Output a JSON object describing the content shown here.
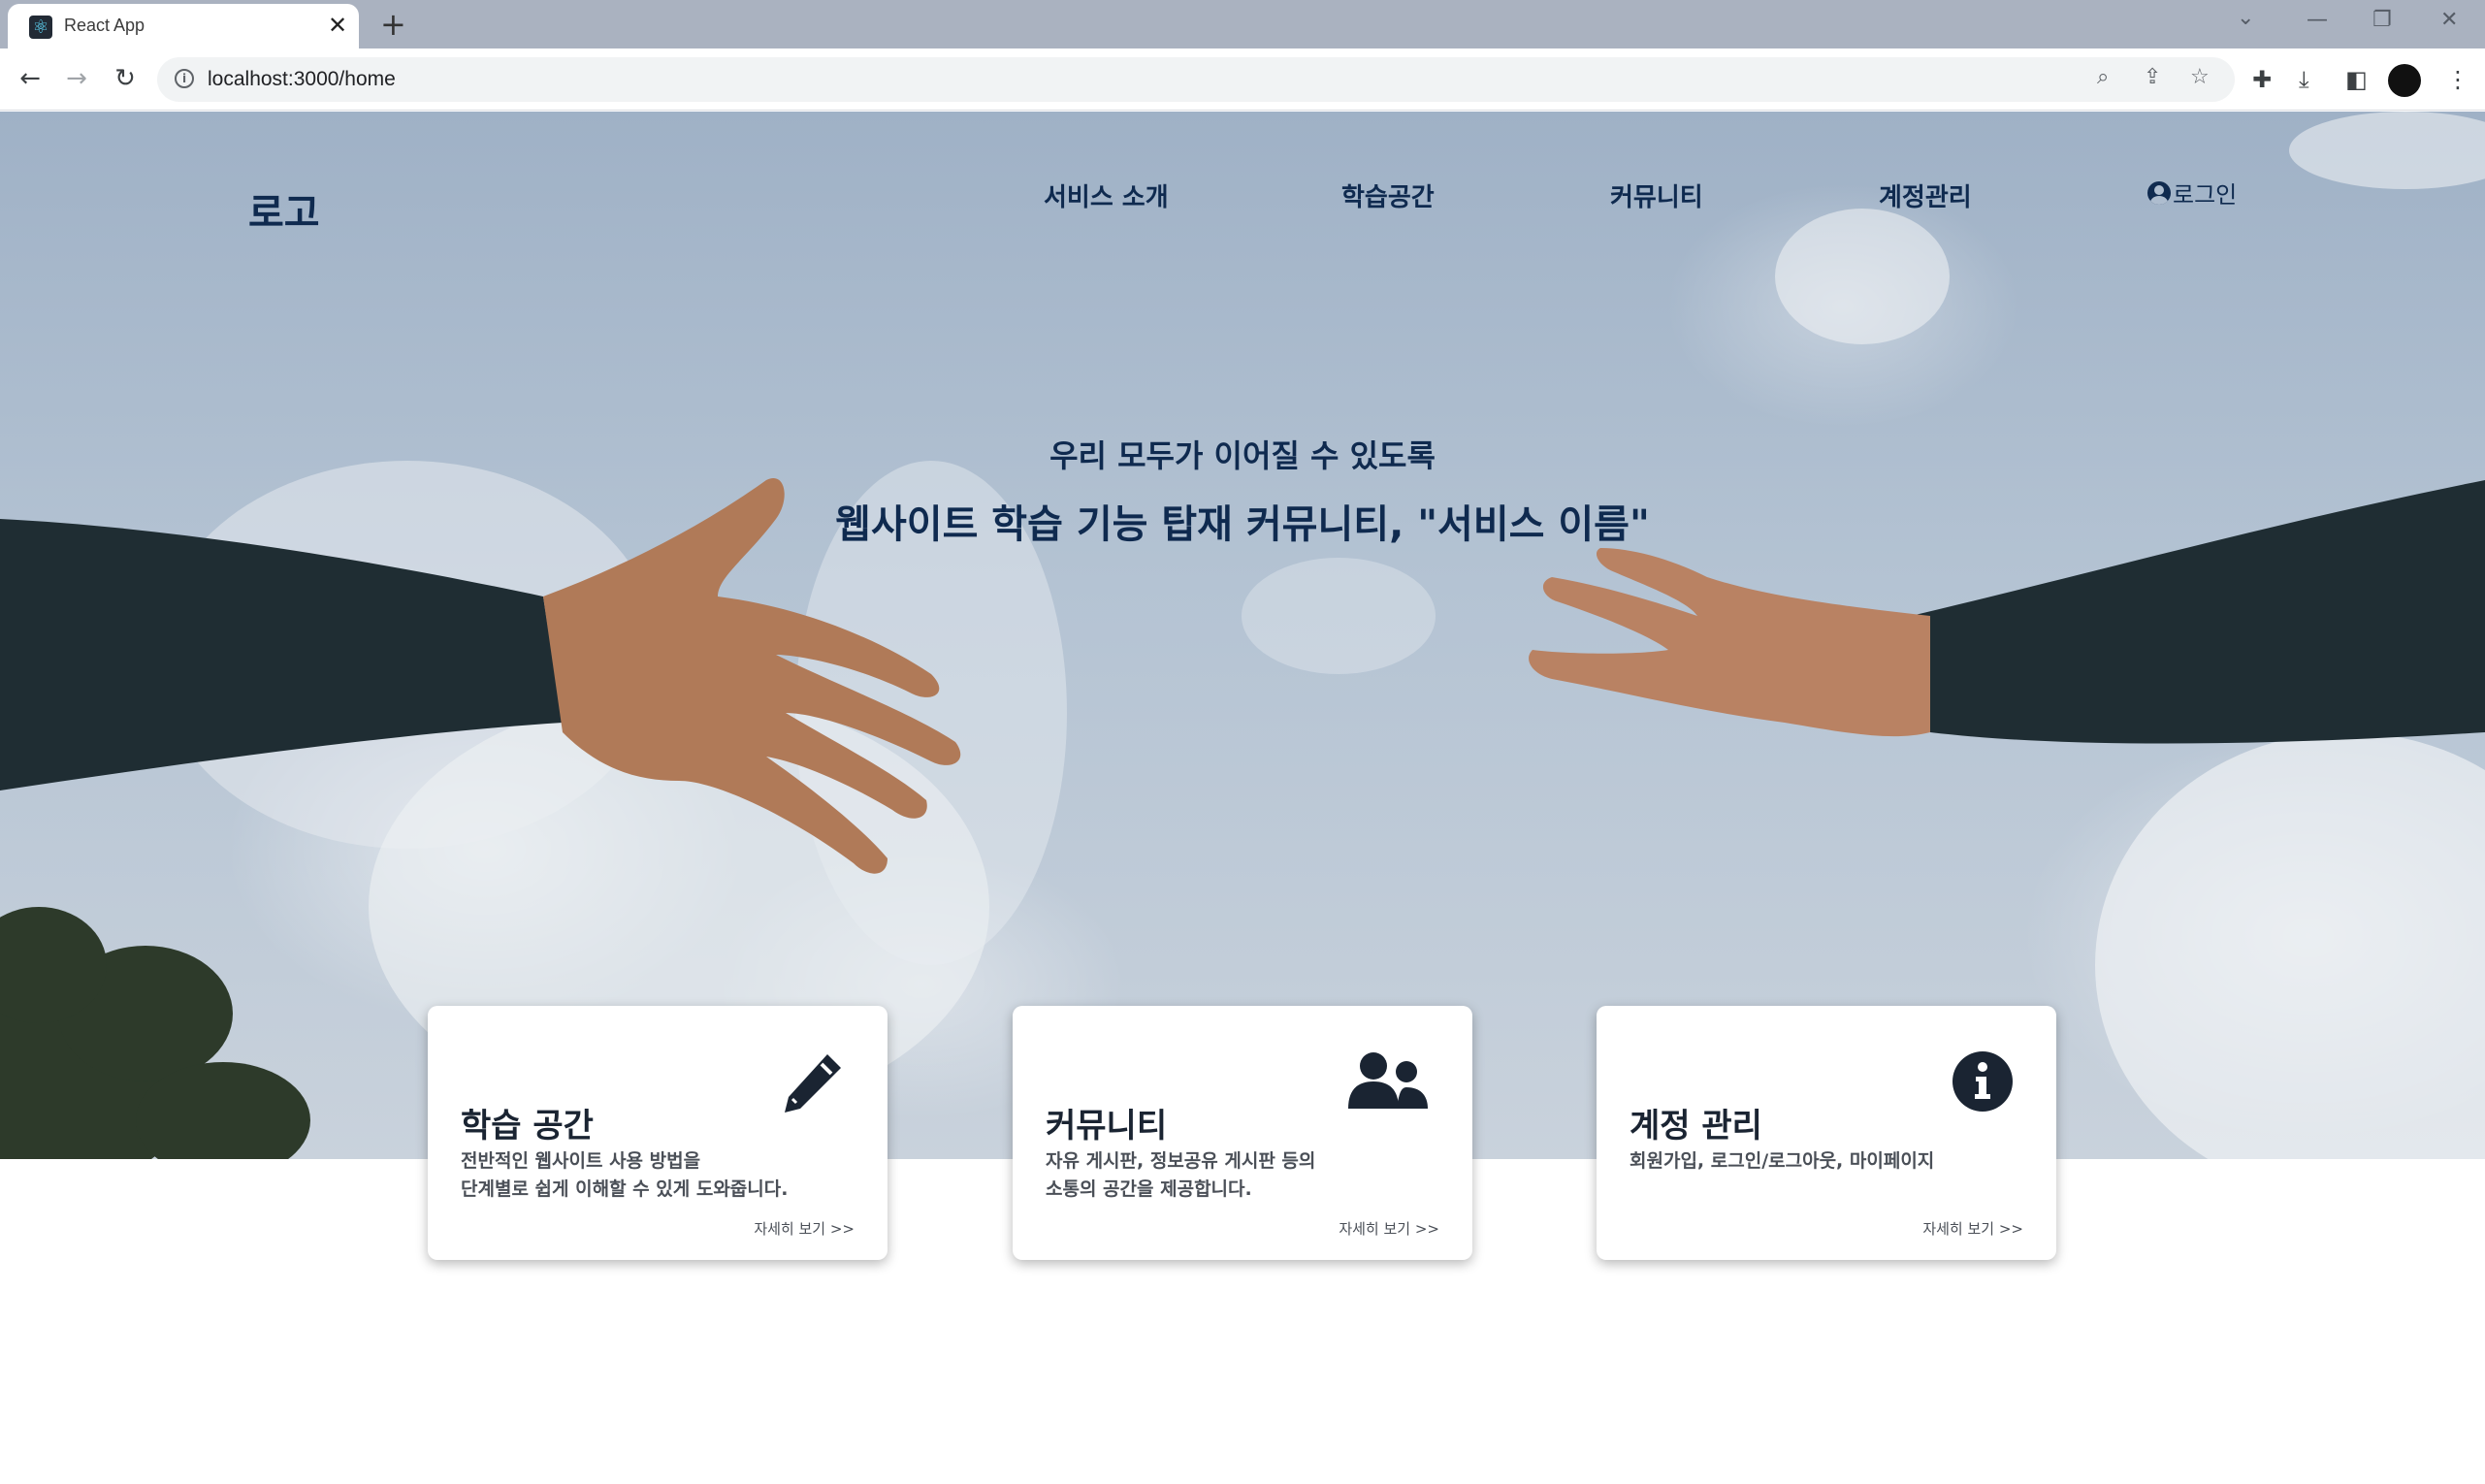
{
  "browser": {
    "tab_title": "React App",
    "tab_close": "✕",
    "new_tab": "+",
    "url": "localhost:3000/home",
    "icons": [
      "react-favicon",
      "back-arrow",
      "forward-arrow",
      "reload",
      "site-info",
      "zoom-magnifier",
      "share",
      "bookmark-star",
      "extensions-puzzle",
      "download",
      "side-panel",
      "profile-avatar",
      "kebab-menu",
      "tab-search-chevron",
      "minimize",
      "restore",
      "close"
    ]
  },
  "site": {
    "logo": "로고",
    "nav": [
      {
        "label": "서비스 소개"
      },
      {
        "label": "학습공간"
      },
      {
        "label": "커뮤니티"
      },
      {
        "label": "계정관리"
      }
    ],
    "login": "로그인"
  },
  "hero": {
    "subtitle": "우리 모두가 이어질 수 있도록",
    "title": "웹사이트 학습 기능 탑재 커뮤니티, \"서비스 이름\""
  },
  "cards": [
    {
      "title": "학습 공간",
      "desc_line1": "전반적인 웹사이트 사용 방법을",
      "desc_line2": "단계별로 쉽게 이해할 수 있게 도와줍니다.",
      "more": "자세히 보기 >>",
      "icon": "pencil-icon"
    },
    {
      "title": "커뮤니티",
      "desc_line1": "자유 게시판, 정보공유 게시판 등의",
      "desc_line2": "소통의 공간을 제공합니다.",
      "more": "자세히 보기 >>",
      "icon": "users-icon"
    },
    {
      "title": "계정 관리",
      "desc_line1": "회원가입, 로그인/로그아웃, 마이페이지",
      "desc_line2": "",
      "more": "자세히 보기 >>",
      "icon": "info-circle-icon"
    }
  ],
  "colors": {
    "brand_navy": "#0f2a4f",
    "card_title": "#1a2432",
    "card_text": "#4a4f57",
    "chrome_tabbar": "#aab2c0"
  }
}
